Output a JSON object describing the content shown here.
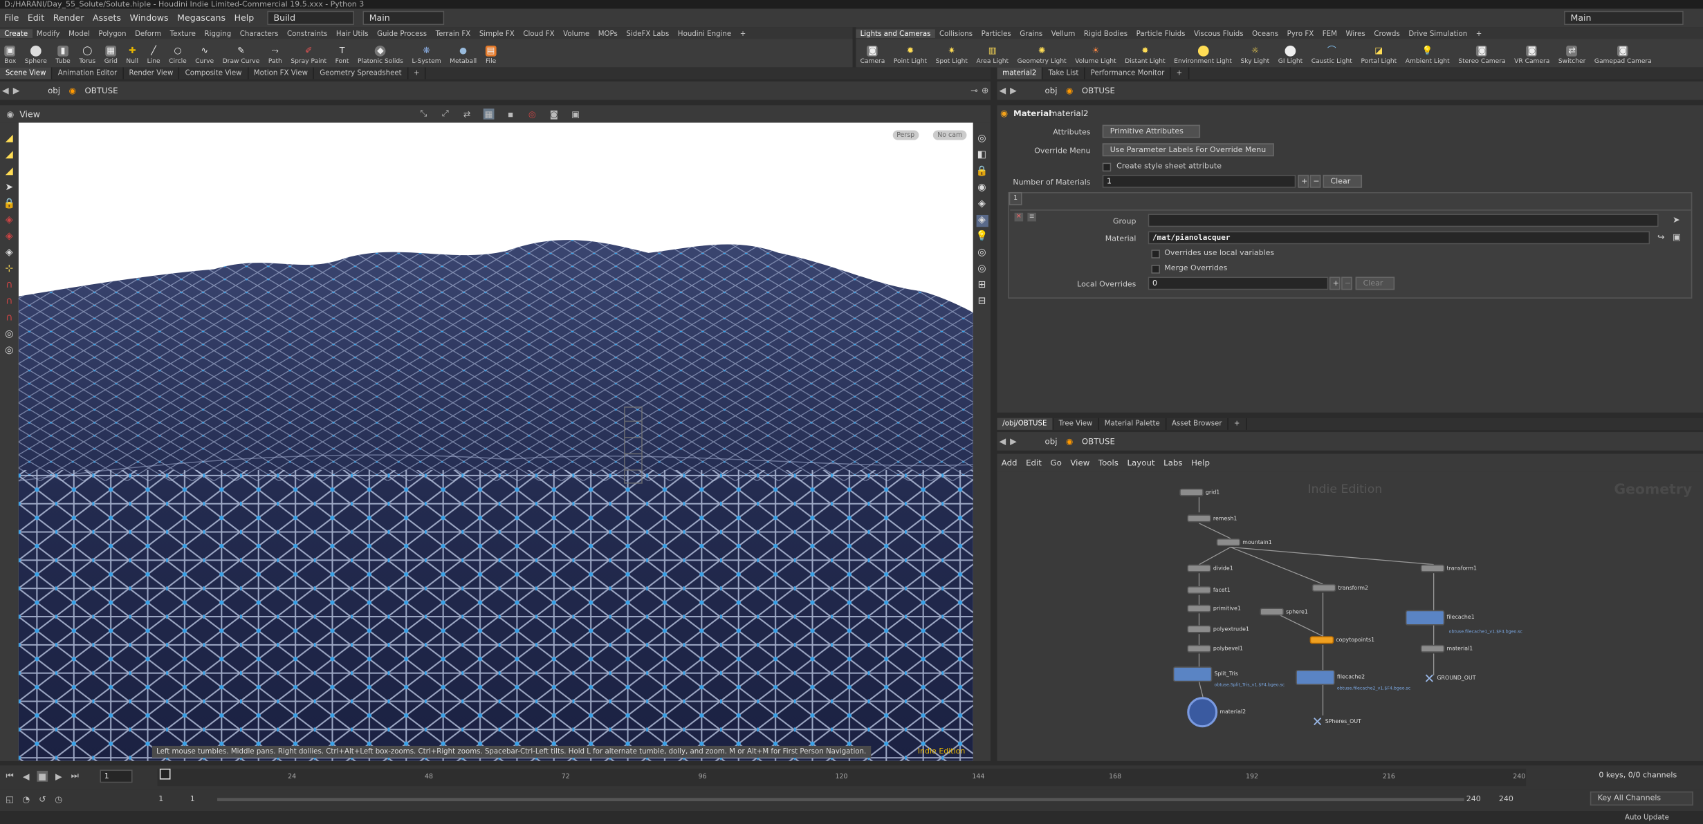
{
  "window": {
    "title": "D:/HARANI/Day_55_Solute/Solute.hiple - Houdini Indie Limited-Commercial 19.5.xxx - Python 3"
  },
  "menu": [
    "File",
    "Edit",
    "Render",
    "Assets",
    "Windows",
    "Megascans",
    "Help"
  ],
  "desktops": {
    "build": "Build",
    "main": "Main",
    "right_main": "Main"
  },
  "shelf_tabs_left": [
    "Create",
    "Modify",
    "Model",
    "Polygon",
    "Deform",
    "Texture",
    "Rigging",
    "Characters",
    "Constraints",
    "Hair Utils",
    "Guide Process",
    "Terrain FX",
    "Simple FX",
    "Cloud FX",
    "Volume",
    "MOPs",
    "SideFX Labs",
    "Houdini Engine"
  ],
  "shelf_tabs_right": [
    "Lights and Cameras",
    "Collisions",
    "Particles",
    "Grains",
    "Vellum",
    "Rigid Bodies",
    "Particle Fluids",
    "Viscous Fluids",
    "Oceans",
    "Pyro FX",
    "FEM",
    "Wires",
    "Crowds",
    "Drive Simulation"
  ],
  "tools_left": [
    {
      "label": "Box",
      "icon": "box-icon"
    },
    {
      "label": "Sphere",
      "icon": "sphere-icon"
    },
    {
      "label": "Tube",
      "icon": "tube-icon"
    },
    {
      "label": "Torus",
      "icon": "torus-icon"
    },
    {
      "label": "Grid",
      "icon": "grid-icon"
    },
    {
      "label": "Null",
      "icon": "null-icon"
    },
    {
      "label": "Line",
      "icon": "line-icon"
    },
    {
      "label": "Circle",
      "icon": "circle-icon"
    },
    {
      "label": "Curve",
      "icon": "curve-icon"
    },
    {
      "label": "Draw Curve",
      "icon": "draw-curve-icon"
    },
    {
      "label": "Path",
      "icon": "path-icon"
    },
    {
      "label": "Spray Paint",
      "icon": "spray-paint-icon"
    },
    {
      "label": "Font",
      "icon": "font-icon"
    },
    {
      "label": "Platonic Solids",
      "icon": "platonic-icon"
    },
    {
      "label": "L-System",
      "icon": "lsystem-icon"
    },
    {
      "label": "Metaball",
      "icon": "metaball-icon"
    },
    {
      "label": "File",
      "icon": "file-icon"
    }
  ],
  "tools_right": [
    {
      "label": "Camera",
      "icon": "camera-icon"
    },
    {
      "label": "Point Light",
      "icon": "point-light-icon"
    },
    {
      "label": "Spot Light",
      "icon": "spot-light-icon"
    },
    {
      "label": "Area Light",
      "icon": "area-light-icon"
    },
    {
      "label": "Geometry Light",
      "icon": "geometry-light-icon"
    },
    {
      "label": "Volume Light",
      "icon": "volume-light-icon"
    },
    {
      "label": "Distant Light",
      "icon": "distant-light-icon"
    },
    {
      "label": "Environment Light",
      "icon": "environment-light-icon"
    },
    {
      "label": "Sky Light",
      "icon": "sky-light-icon"
    },
    {
      "label": "GI Light",
      "icon": "gi-light-icon"
    },
    {
      "label": "Caustic Light",
      "icon": "caustic-light-icon"
    },
    {
      "label": "Portal Light",
      "icon": "portal-light-icon"
    },
    {
      "label": "Ambient Light",
      "icon": "ambient-light-icon"
    },
    {
      "label": "Stereo Camera",
      "icon": "stereo-camera-icon"
    },
    {
      "label": "VR Camera",
      "icon": "vr-camera-icon"
    },
    {
      "label": "Switcher",
      "icon": "switcher-icon"
    },
    {
      "label": "Gamepad Camera",
      "icon": "gamepad-camera-icon"
    }
  ],
  "left_pane_tabs": [
    "Scene View",
    "Animation Editor",
    "Render View",
    "Composite View",
    "Motion FX View",
    "Geometry Spreadsheet"
  ],
  "right_top_tabs": [
    "material2",
    "Take List",
    "Performance Monitor"
  ],
  "path": {
    "obj": "obj",
    "node": "OBTUSE"
  },
  "viewport": {
    "title": "View",
    "persp": "Persp",
    "cam": "No cam",
    "hint": "Left mouse tumbles. Middle pans. Right dollies. Ctrl+Alt+Left box-zooms. Ctrl+Right zooms. Spacebar-Ctrl-Left tilts. Hold L for alternate tumble, dolly, and zoom.    M or Alt+M for First Person Navigation.",
    "indie": "Indie Edition"
  },
  "params": {
    "node_type": "Material",
    "node_name": "material2",
    "attributes_label": "Attributes",
    "attributes_value": "Primitive Attributes",
    "override_label": "Override Menu",
    "override_value": "Use Parameter Labels For Override Menu",
    "style_sheet": "Create style sheet attribute",
    "num_label": "Number of Materials",
    "num_value": "1",
    "clear": "Clear",
    "tab": "1",
    "group_label": "Group",
    "group_value": "",
    "material_label": "Material",
    "material_value": "/mat/pianolacquer",
    "local_vars": "Overrides use local variables",
    "merge": "Merge Overrides",
    "local_over_label": "Local Overrides",
    "local_over_value": "0",
    "clear2": "Clear"
  },
  "net_tabs": [
    "/obj/OBTUSE",
    "Tree View",
    "Material Palette",
    "Asset Browser"
  ],
  "net_menu": [
    "Add",
    "Edit",
    "Go",
    "View",
    "Tools",
    "Layout",
    "Labs",
    "Help"
  ],
  "net": {
    "indie": "Indie Edition",
    "context": "Geometry"
  },
  "nodes": [
    {
      "name": "grid1",
      "color": "gray"
    },
    {
      "name": "remesh1",
      "color": "gray"
    },
    {
      "name": "mountain1",
      "color": "gray"
    },
    {
      "name": "divide1",
      "color": "gray"
    },
    {
      "name": "facet1",
      "color": "gray"
    },
    {
      "name": "primitive1",
      "color": "gray"
    },
    {
      "name": "polyextrude1",
      "color": "gray"
    },
    {
      "name": "polybevel1",
      "color": "gray"
    },
    {
      "name": "Split_Tris",
      "color": "blue"
    },
    {
      "name": "material2",
      "color": "gray"
    },
    {
      "name": "transform2",
      "color": "gray"
    },
    {
      "name": "sphere1",
      "color": "gray"
    },
    {
      "name": "copytopoints1",
      "color": "orange"
    },
    {
      "name": "filecache2",
      "color": "blue"
    },
    {
      "name": "SPheres_OUT",
      "color": "gray"
    },
    {
      "name": "transform1",
      "color": "gray"
    },
    {
      "name": "filecache1",
      "color": "blue"
    },
    {
      "name": "material1",
      "color": "gray"
    },
    {
      "name": "GROUND_OUT",
      "color": "gray"
    }
  ],
  "node_subtext": {
    "split": "obtuse.Split_Tris_v1.$F4.bgeo.sc",
    "fc2": "obtuse.filecache2_v1.$F4.bgeo.sc",
    "fc1": "obtuse.filecache1_v1.$F4.bgeo.sc"
  },
  "timeline": {
    "frame": "1",
    "ticks": [
      "1",
      "24",
      "48",
      "72",
      "96",
      "120",
      "144",
      "168",
      "192",
      "216",
      "240"
    ],
    "start": "1",
    "start2": "1",
    "end": "240",
    "end2": "240",
    "keys": "0 keys, 0/0 channels",
    "key_all": "Key All Channels",
    "auto_update": "Auto Update"
  },
  "colors": {
    "accent": "#e7b600",
    "node_orange": "#f0a020",
    "node_blue": "#5a84c4",
    "viewport_sky": "#ffffff",
    "terrain": "#232b4f"
  }
}
